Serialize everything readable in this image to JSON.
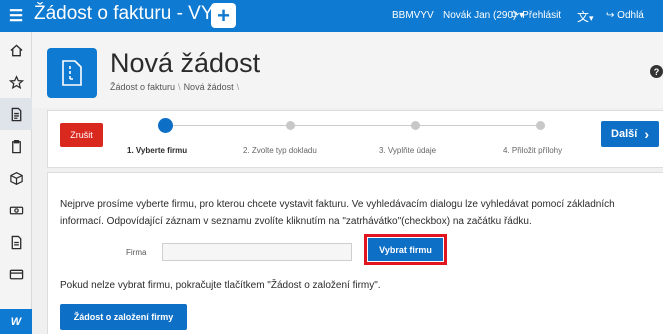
{
  "topbar": {
    "menu_icon": "hamburger-icon",
    "app_title": "Žádost o fakturu - VYV",
    "add_icon": "plus-icon",
    "user_code": "BBMVYV",
    "user_name": "Novák Jan (290)",
    "user_chevron": "▾",
    "switch_label": "Přehlásit",
    "language_icon": "translate-icon",
    "language_chevron": "▾",
    "logout_label": "Odhlá"
  },
  "leftnav": {
    "items": [
      {
        "icon": "home-icon"
      },
      {
        "icon": "star-icon"
      },
      {
        "icon": "document-icon"
      },
      {
        "icon": "clipboard-icon"
      },
      {
        "icon": "box-icon"
      },
      {
        "icon": "money-icon"
      },
      {
        "icon": "file-icon"
      },
      {
        "icon": "card-icon"
      }
    ],
    "bottom_logo": "W"
  },
  "header": {
    "title": "Nová žádost",
    "breadcrumb": [
      "Žádost o fakturu",
      "Nová žádost"
    ],
    "help": "?"
  },
  "wizard": {
    "cancel_label": "Zrušit",
    "next_label": "Další",
    "steps": [
      {
        "label": "1. Vyberte firmu",
        "active": true
      },
      {
        "label": "2. Zvolte typ dokladu",
        "active": false
      },
      {
        "label": "3. Vyplňte údaje",
        "active": false
      },
      {
        "label": "4. Přiložit přílohy",
        "active": false
      }
    ]
  },
  "content": {
    "intro_text": "Nejprve prosíme vyberte firmu, pro kterou chcete vystavit fakturu. Ve vyhledávacím dialogu lze vyhledávat pomocí základních informací. Odpovídající záznam v seznamu zvolíte kliknutím na \"zatrhávátko\"(checkbox) na začátku řádku.",
    "firm_label": "Firma",
    "firm_value": "",
    "select_button": "Vybrat firmu",
    "fallback_text": "Pokud nelze vybrat firmu, pokračujte tlačítkem \"Žádost o založení firmy\".",
    "create_button": "Žádost o založení firmy"
  },
  "colors": {
    "brand": "#0e7ad1",
    "primary_button": "#0e6fc6",
    "danger": "#d9281e",
    "highlight": "#e0151f"
  }
}
